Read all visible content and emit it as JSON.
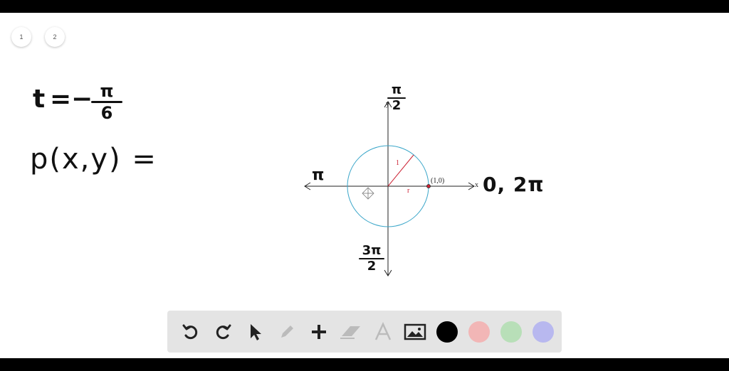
{
  "pages": [
    "1",
    "2"
  ],
  "notes": {
    "line1_var": "t",
    "line1_eq": "=",
    "line1_minus": "−",
    "line1_num": "π",
    "line1_den": "6",
    "line2": "p(x,y) ="
  },
  "diagram": {
    "top_num": "π",
    "top_den": "2",
    "left": "π",
    "right": "0, 2π",
    "bottom_num": "3π",
    "bottom_den": "2",
    "y_label": "y",
    "x_label": "x",
    "point_label": "(1,0)",
    "radius_label": "1",
    "r_label": "r",
    "circle_color": "#3aa6c9",
    "radius_color": "#cc2233"
  },
  "toolbar": {
    "tools": [
      "undo-icon",
      "redo-icon",
      "pointer-icon",
      "pen-icon",
      "add-icon",
      "eraser-icon",
      "text-icon",
      "image-icon"
    ],
    "colors": [
      "#000000",
      "#f2b6b6",
      "#b8dfb8",
      "#b8b8ef"
    ]
  }
}
